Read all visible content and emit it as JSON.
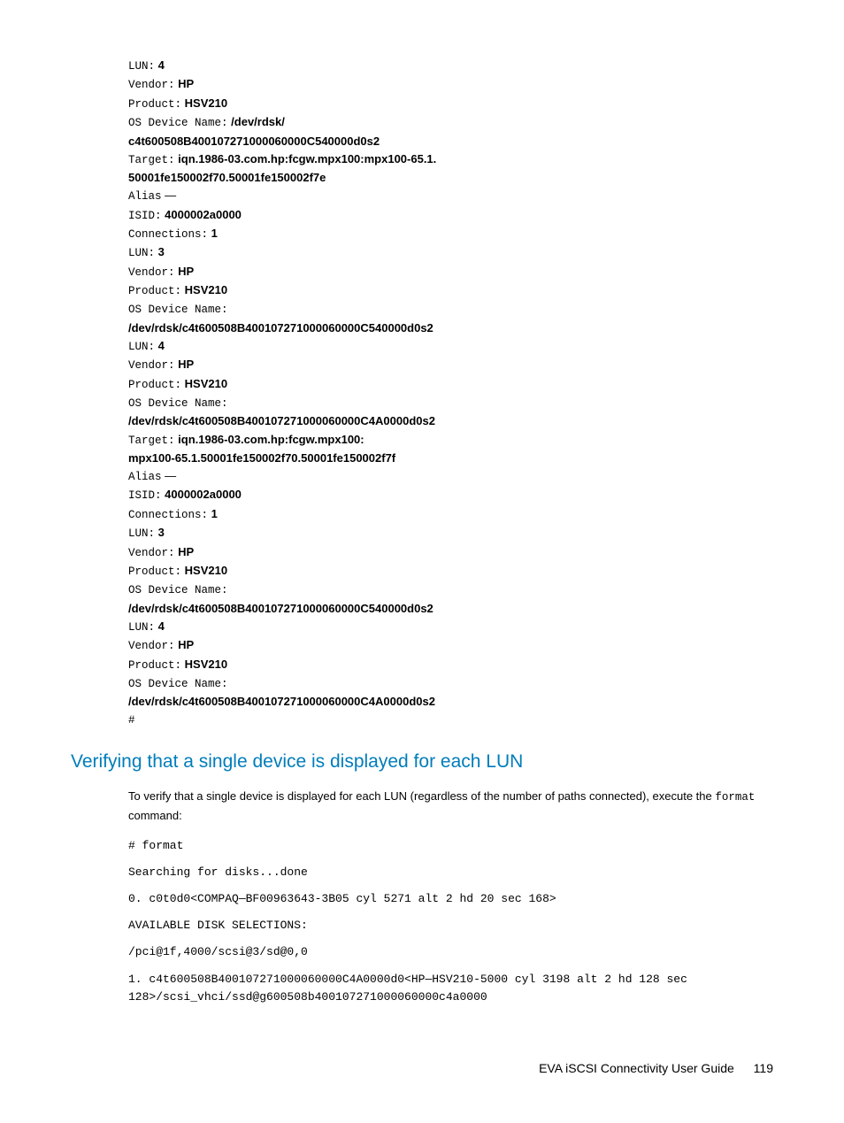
{
  "lines": [
    {
      "label": "LUN:",
      "value": "4"
    },
    {
      "label": "Vendor:",
      "value": "HP"
    },
    {
      "label": "Product:",
      "value": "HSV210"
    },
    {
      "label": "OS Device Name:",
      "value": "/dev/rdsk/",
      "cont": true
    },
    {
      "bold_only": "c4t600508B400107271000060000C540000d0s2"
    },
    {
      "label": "Target:",
      "value": "iqn.1986-03.com.hp:fcgw.mpx100:mpx100-65.1.",
      "cont": true
    },
    {
      "bold_only": "50001fe150002f70.50001fe150002f7e"
    },
    {
      "label": "Alias",
      "plain_after": " —"
    },
    {
      "label": "ISID:",
      "value": "4000002a0000"
    },
    {
      "label": "Connections:",
      "value": "1"
    },
    {
      "label": "LUN:",
      "value": "3"
    },
    {
      "label": "Vendor:",
      "value": "HP"
    },
    {
      "label": "Product:",
      "value": "HSV210"
    },
    {
      "label": "OS Device Name:"
    },
    {
      "bold_only": "/dev/rdsk/c4t600508B400107271000060000C540000d0s2"
    },
    {
      "label": "LUN:",
      "value": "4"
    },
    {
      "label": "Vendor:",
      "value": "HP"
    },
    {
      "label": "Product:",
      "value": "HSV210"
    },
    {
      "label": "OS Device Name:"
    },
    {
      "bold_only": "/dev/rdsk/c4t600508B400107271000060000C4A0000d0s2"
    },
    {
      "label": "Target:",
      "value": "iqn.1986-03.com.hp:fcgw.mpx100:",
      "cont": true
    },
    {
      "bold_only": "mpx100-65.1.50001fe150002f70.50001fe150002f7f"
    },
    {
      "label": "Alias",
      "plain_after": " —"
    },
    {
      "label": "ISID:",
      "value": "4000002a0000"
    },
    {
      "label": "Connections:",
      "value": "1"
    },
    {
      "label": "LUN:",
      "value": "3"
    },
    {
      "label": "Vendor:",
      "value": "HP"
    },
    {
      "label": "Product:",
      "value": "HSV210"
    },
    {
      "label": "OS Device Name:"
    },
    {
      "bold_only": "/dev/rdsk/c4t600508B400107271000060000C540000d0s2"
    },
    {
      "label": "LUN:",
      "value": "4"
    },
    {
      "label": "Vendor:",
      "value": "HP"
    },
    {
      "label": "Product:",
      "value": "HSV210"
    },
    {
      "label": "OS Device Name:"
    },
    {
      "bold_only": "/dev/rdsk/c4t600508B400107271000060000C4A0000d0s2"
    },
    {
      "label": "#"
    }
  ],
  "section_heading": "Verifying that a single device is displayed for each LUN",
  "section_para_pre": "To verify that a single device is displayed for each LUN (regardless of the number of paths connected), execute the ",
  "section_para_code": "format",
  "section_para_post": " command:",
  "code_lines": [
    "# format",
    "Searching for disks...done",
    "0. c0t0d0<COMPAQ—BF00963643-3B05 cyl 5271 alt 2 hd 20 sec 168>",
    "AVAILABLE DISK SELECTIONS:",
    "/pci@1f,4000/scsi@3/sd@0,0",
    "1. c4t600508B400107271000060000C4A0000d0<HP—HSV210-5000 cyl 3198 alt 2 hd 128 sec 128>/scsi_vhci/ssd@g600508b400107271000060000c4a0000"
  ],
  "footer_title": "EVA iSCSI Connectivity User Guide",
  "footer_page": "119"
}
